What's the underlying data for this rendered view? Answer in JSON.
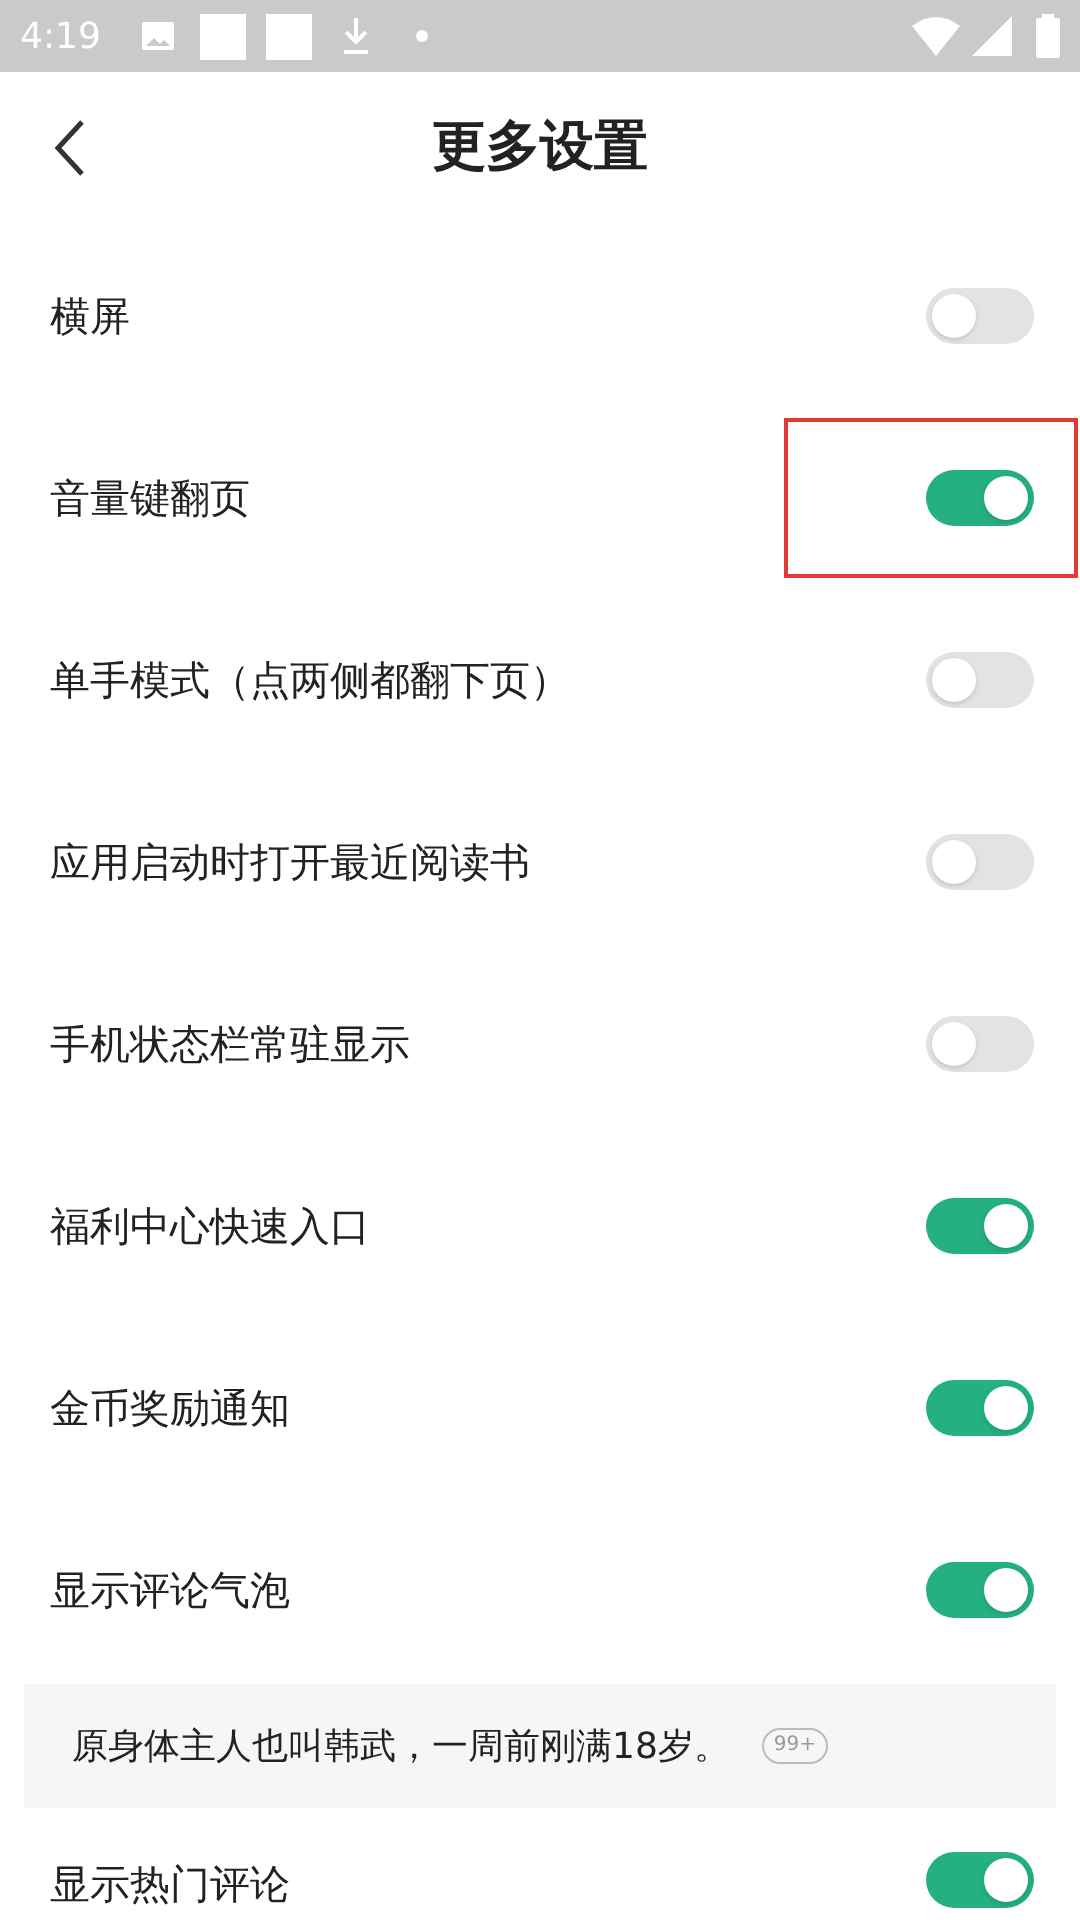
{
  "status_bar": {
    "time": "4:19"
  },
  "header": {
    "title": "更多设置"
  },
  "settings": [
    {
      "label": "横屏",
      "on": false,
      "highlighted": false
    },
    {
      "label": "音量键翻页",
      "on": true,
      "highlighted": true
    },
    {
      "label": "单手模式（点两侧都翻下页）",
      "on": false,
      "highlighted": false
    },
    {
      "label": "应用启动时打开最近阅读书",
      "on": false,
      "highlighted": false
    },
    {
      "label": "手机状态栏常驻显示",
      "on": false,
      "highlighted": false
    },
    {
      "label": "福利中心快速入口",
      "on": true,
      "highlighted": false
    },
    {
      "label": "金币奖励通知",
      "on": true,
      "highlighted": false
    },
    {
      "label": "显示评论气泡",
      "on": true,
      "highlighted": false
    }
  ],
  "comment_preview": {
    "text": "原身体主人也叫韩武，一周前刚满18岁。",
    "bubble": "99+"
  },
  "last_setting": {
    "label": "显示热门评论",
    "on": true
  }
}
